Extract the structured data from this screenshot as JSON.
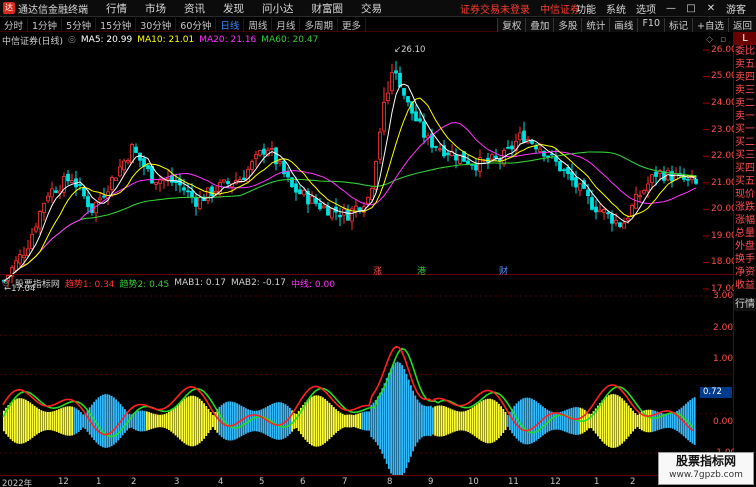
{
  "titlebar": {
    "logo": "达",
    "app_title": "通达信金融终端",
    "menus": [
      "行情",
      "市场",
      "资讯",
      "发现",
      "问小达",
      "财富圈",
      "交易"
    ],
    "notice": [
      "证券交易未登录",
      "中信证券"
    ],
    "right_menus": [
      "功能",
      "系统",
      "选项"
    ],
    "guest": "游客"
  },
  "periodbar": {
    "periods": [
      "分时",
      "1分钟",
      "5分钟",
      "15分钟",
      "30分钟",
      "60分钟",
      "日线",
      "周线",
      "月线",
      "多周期",
      "更多"
    ],
    "active_period": "日线",
    "tools": [
      "复权",
      "叠加",
      "多股",
      "统计",
      "画线",
      "F10",
      "标记",
      "+自选",
      "返回"
    ]
  },
  "stock": {
    "name": "中信证券(日线)",
    "ma5_label": "MA5: 20.99",
    "ma10_label": "MA10: 21.01",
    "ma20_label": "MA20: 21.16",
    "ma60_label": "MA60: 20.47",
    "high_marker": "26.10",
    "low_marker": "17.04"
  },
  "price_axis": [
    "26.00",
    "25.00",
    "24.00",
    "23.00",
    "22.00",
    "21.00",
    "20.00",
    "19.00",
    "18.00",
    "17.00"
  ],
  "events": [
    {
      "text": "涨",
      "color": "#ff4d4d"
    },
    {
      "text": "港",
      "color": "#33cc33"
    },
    {
      "text": "财",
      "color": "#4d8dff"
    }
  ],
  "indicator": {
    "name": "股票指标网",
    "trend1": "趋势1: 0.34",
    "trend2": "趋势2: 0.45",
    "mab1": "MAB1: 0.17",
    "mab2": "MAB2: -0.17",
    "midline": "中线: 0.00",
    "current_value": "0.72",
    "axis": [
      "3.00",
      "2.00",
      "1.00",
      "0.00",
      "-1.00"
    ]
  },
  "side_panel": [
    "L",
    "委比",
    "卖五",
    "卖四",
    "卖三",
    "卖二",
    "卖一",
    "买一",
    "买二",
    "买三",
    "买四",
    "买五",
    "现价",
    "涨跌",
    "涨幅",
    "总量",
    "外盘",
    "换手",
    "净资",
    "收益",
    "行情"
  ],
  "dates": [
    "2022年",
    "12",
    "1",
    "2",
    "3",
    "4",
    "5",
    "6",
    "7",
    "8",
    "9",
    "10",
    "11",
    "12",
    "1",
    "2",
    "3"
  ],
  "watermark": {
    "line1": "股票指标网",
    "line2": "www.7gpzb.com"
  },
  "colors": {
    "up": "#ff3333",
    "down": "#00e0e0",
    "ma5": "#ffffff",
    "ma10": "#ffff00",
    "ma20": "#ff33ff",
    "ma60": "#33cc33",
    "hist_yellow": "#ffff33",
    "hist_cyan": "#33bbff",
    "trend1": "#ff2222",
    "trend2": "#22dd22"
  }
}
